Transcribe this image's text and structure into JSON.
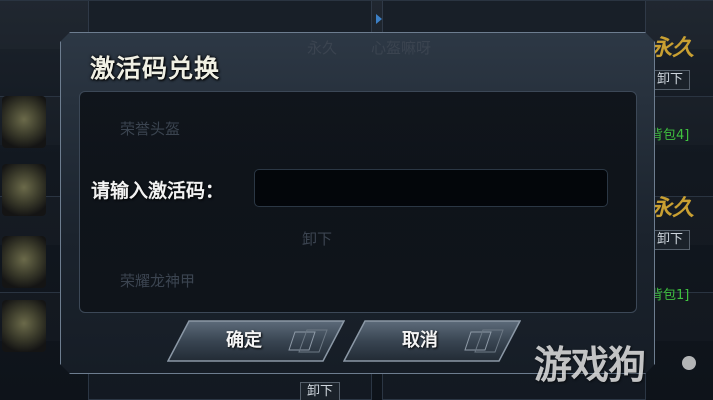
{
  "dialog": {
    "title": "激活码兑换",
    "code_label": "请输入激活码：",
    "code_value": "",
    "code_placeholder": "",
    "confirm_label": "确定",
    "cancel_label": "取消"
  },
  "background": {
    "unequip_label": "卸下",
    "bag_label_a": "背包4]",
    "bag_label_b": "背包1]",
    "permanent_label": "永久",
    "ghost_texts": [
      "永久",
      "心盔嘛呀",
      "荣誉头盔",
      "荣耀龙神甲",
      "卸下"
    ]
  },
  "watermark": "游戏狗",
  "colors": {
    "dialog_border": "#6d7d8f",
    "accent_green": "#3fc23f",
    "accent_gold": "#c9a032",
    "accent_blue": "#3c80c7"
  }
}
